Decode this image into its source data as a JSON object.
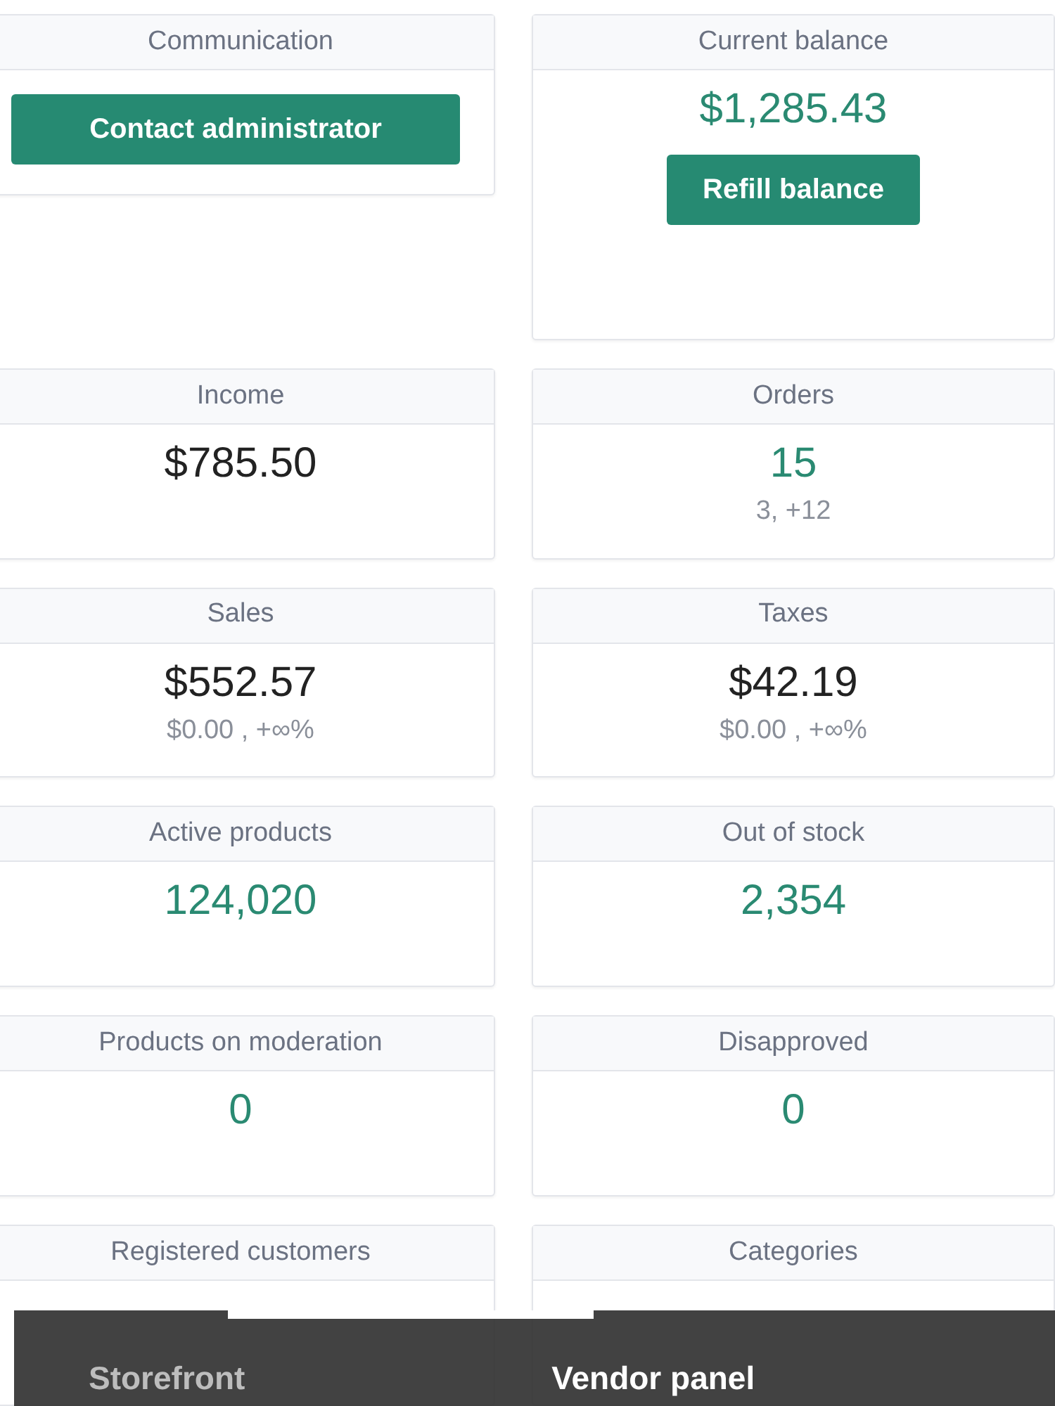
{
  "cards": [
    {
      "title": "Communication",
      "kind": "button",
      "button": "Contact administrator"
    },
    {
      "title": "Current balance",
      "kind": "value_button",
      "value": "$1,285.43",
      "highlighted": true,
      "button": "Refill balance"
    },
    {
      "title": "Income",
      "kind": "value",
      "value": "$785.50",
      "highlighted": false
    },
    {
      "title": "Orders",
      "kind": "value",
      "value": "15",
      "highlighted": true,
      "subtext": "3, +12"
    },
    {
      "title": "Sales",
      "kind": "value",
      "value": "$552.57",
      "highlighted": false,
      "subtext": "$0.00 , +∞%"
    },
    {
      "title": "Taxes",
      "kind": "value",
      "value": "$42.19",
      "highlighted": false,
      "subtext": "$0.00 , +∞%"
    },
    {
      "title": "Active products",
      "kind": "value",
      "value": "124,020",
      "highlighted": true
    },
    {
      "title": "Out of stock",
      "kind": "value",
      "value": "2,354",
      "highlighted": true
    },
    {
      "title": "Products on moderation",
      "kind": "value",
      "value": "0",
      "highlighted": true
    },
    {
      "title": "Disapproved",
      "kind": "value",
      "value": "0",
      "highlighted": true
    },
    {
      "title": "Registered customers",
      "kind": "value"
    },
    {
      "title": "Categories",
      "kind": "value"
    }
  ],
  "bottom_tabs": [
    {
      "label": "Storefront",
      "selected": false
    },
    {
      "label": "Vendor panel",
      "selected": true
    }
  ]
}
